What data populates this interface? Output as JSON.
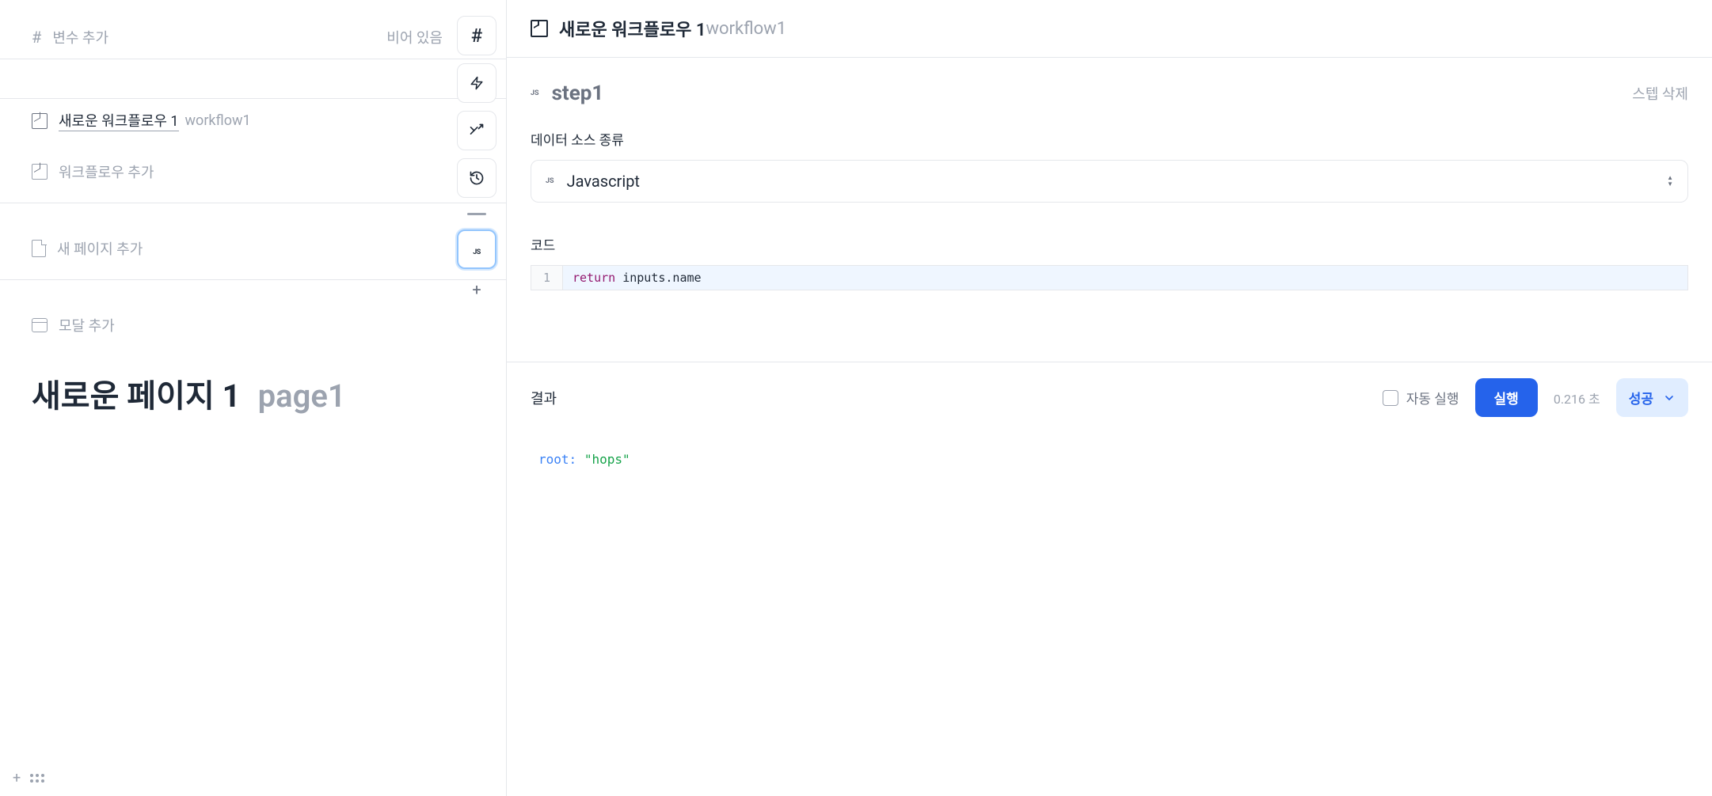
{
  "sidebar": {
    "variable_add": "변수 추가",
    "variable_empty": "비어 있음",
    "workflow": {
      "title": "새로운 워크플로우 1",
      "id": "workflow1"
    },
    "workflow_add": "워크플로우 추가",
    "page_add": "새 페이지 추가",
    "modal_add": "모달 추가",
    "page_title": "새로운 페이지 1",
    "page_id": "page1"
  },
  "toolbar": {
    "js_label": "JS"
  },
  "right": {
    "header": {
      "title": "새로운 워크플로우 1",
      "id": "workflow1"
    },
    "step": {
      "js_badge": "JS",
      "name": "step1",
      "delete_label": "스텝 삭제"
    },
    "datasource": {
      "label": "데이터 소스 종류",
      "value": "Javascript",
      "js_badge": "JS"
    },
    "code": {
      "label": "코드",
      "line_num": "1",
      "kw": "return",
      "expr": " inputs.name"
    },
    "result": {
      "label": "결과",
      "auto_run": "자동 실행",
      "run": "실행",
      "timing": "0.216 초",
      "success": "성공",
      "root_key": "root:",
      "root_val": "\"hops\""
    }
  }
}
